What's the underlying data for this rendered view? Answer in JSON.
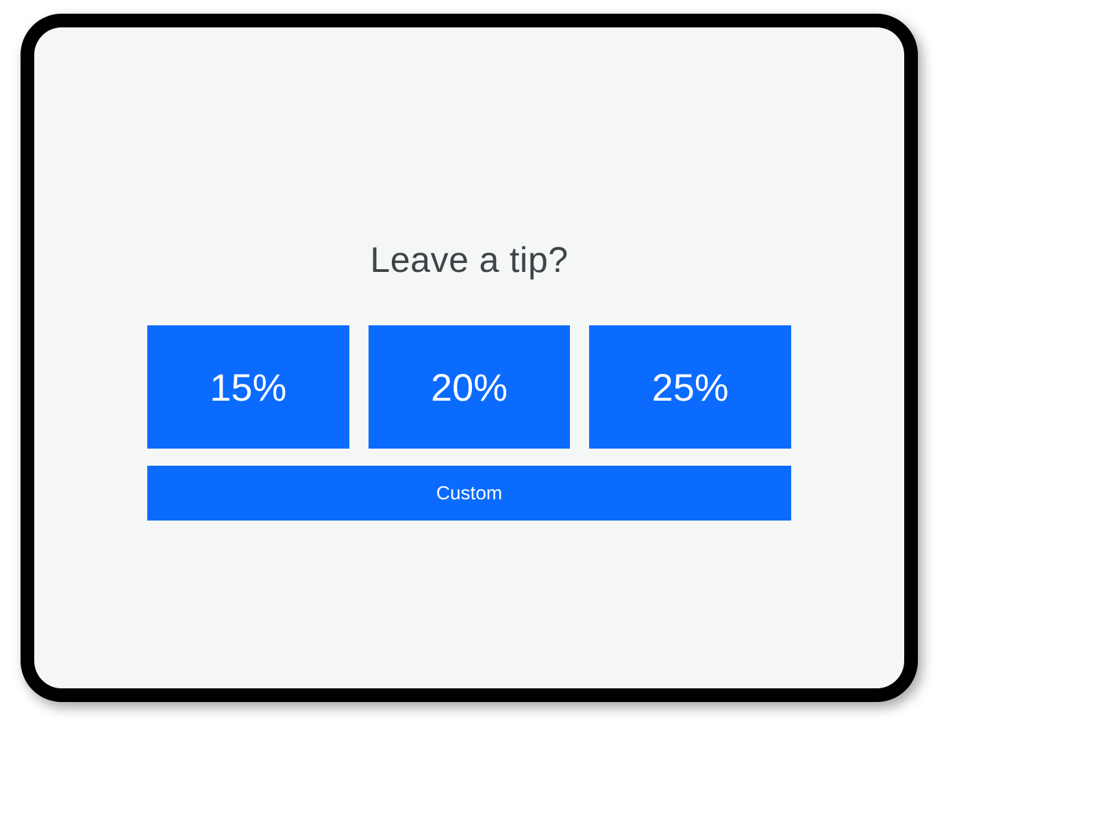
{
  "prompt": "Leave a tip?",
  "tip_options": [
    {
      "label": "15%"
    },
    {
      "label": "20%"
    },
    {
      "label": "25%"
    }
  ],
  "custom_label": "Custom",
  "colors": {
    "accent": "#0b6bff",
    "screen_bg": "#f5f6f6",
    "text": "#3e4448"
  }
}
